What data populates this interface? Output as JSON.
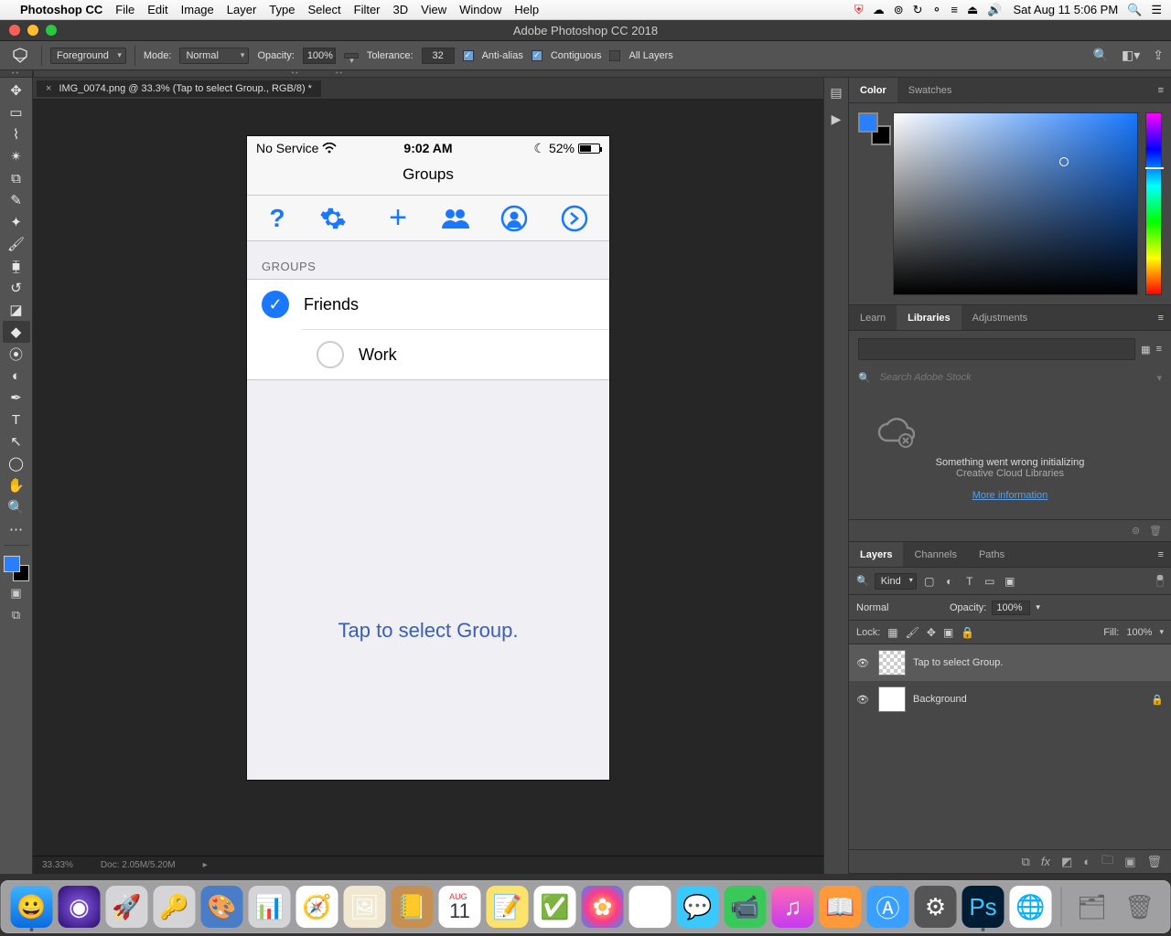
{
  "mac": {
    "app_name": "Photoshop CC",
    "menus": [
      "File",
      "Edit",
      "Image",
      "Layer",
      "Type",
      "Select",
      "Filter",
      "3D",
      "View",
      "Window",
      "Help"
    ],
    "clock": "Sat Aug 11  5:06 PM"
  },
  "window": {
    "title": "Adobe Photoshop CC 2018"
  },
  "options": {
    "fill_mode": "Foreground",
    "mode_label": "Mode:",
    "mode_value": "Normal",
    "opacity_label": "Opacity:",
    "opacity_value": "100%",
    "tolerance_label": "Tolerance:",
    "tolerance_value": "32",
    "antialias": "Anti-alias",
    "contiguous": "Contiguous",
    "all_layers": "All Layers"
  },
  "doc_tab": "IMG_0074.png @ 33.3% (Tap to select Group., RGB/8) *",
  "status": {
    "zoom": "33.33%",
    "doc": "Doc: 2.05M/5.20M"
  },
  "ios": {
    "carrier": "No Service",
    "time": "9:02 AM",
    "battery": "52%",
    "nav_title": "Groups",
    "section_head": "GROUPS",
    "rows": [
      {
        "label": "Friends",
        "checked": true
      },
      {
        "label": "Work",
        "checked": false
      }
    ],
    "hint": "Tap to select Group."
  },
  "panels": {
    "color_tab": "Color",
    "swatches_tab": "Swatches",
    "learn_tab": "Learn",
    "libraries_tab": "Libraries",
    "adjustments_tab": "Adjustments",
    "lib_search_placeholder": "Search Adobe Stock",
    "lib_error1": "Something went wrong initializing",
    "lib_error2": "Creative Cloud Libraries",
    "lib_link": "More information",
    "layers_tab": "Layers",
    "channels_tab": "Channels",
    "paths_tab": "Paths",
    "layers": {
      "filter_kind": "Kind",
      "blend_mode": "Normal",
      "opacity_label": "Opacity:",
      "opacity_value": "100%",
      "lock_label": "Lock:",
      "fill_label": "Fill:",
      "fill_value": "100%",
      "items": [
        {
          "name": "Tap to select Group.",
          "selected": true,
          "transparent": true,
          "locked": false
        },
        {
          "name": "Background",
          "selected": false,
          "transparent": false,
          "locked": true
        }
      ]
    }
  },
  "lib_view_icons": [
    "grid-view",
    "list-view"
  ]
}
